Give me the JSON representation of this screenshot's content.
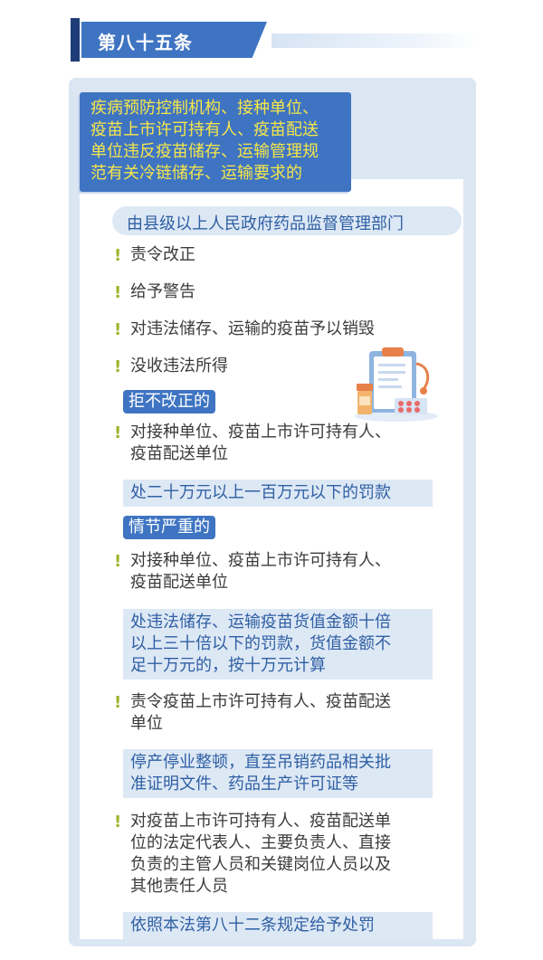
{
  "header": {
    "title": "第八十五条"
  },
  "title_box": {
    "lines": [
      "疾病预防控制机构、接种单位、",
      "疫苗上市许可持有人、疫苗配送",
      "单位违反疫苗储存、运输管理规",
      "范有关冷链储存、运输要求的"
    ]
  },
  "authority": "由县级以上人民政府药品监督管理部门",
  "penalties": [
    "责令改正",
    "给予警告",
    "对违法储存、运输的疫苗予以销毁",
    "没收违法所得"
  ],
  "refuse": {
    "badge": "拒不改正的",
    "target_lines": [
      "对接种单位、疫苗上市许可持有人、",
      "疫苗配送单位"
    ],
    "result": "处二十万元以上一百万元以下的罚款"
  },
  "serious": {
    "badge": "情节严重的",
    "items": [
      {
        "target_lines": [
          "对接种单位、疫苗上市许可持有人、",
          "疫苗配送单位"
        ],
        "result_lines": [
          "处违法储存、运输疫苗货值金额十倍",
          "以上三十倍以下的罚款，货值金额不",
          "足十万元的，按十万元计算"
        ]
      },
      {
        "target_lines": [
          "责令疫苗上市许可持有人、疫苗配送",
          "单位"
        ],
        "result_lines": [
          "停产停业整顿，直至吊销药品相关批",
          "准证明文件、药品生产许可证等"
        ]
      },
      {
        "target_lines": [
          "对疫苗上市许可持有人、疫苗配送单",
          "位的法定代表人、主要负责人、直接",
          "负责的主管人员和关键岗位人员以及",
          "其他责任人员"
        ],
        "result_lines": [
          "依照本法第八十二条规定给予处罚"
        ]
      }
    ]
  },
  "colors": {
    "primary": "#3e74c2",
    "navy": "#1e3d78",
    "panel": "#dbe6f3",
    "highlight_text": "#f6e64a",
    "bullet": "#9fb32a",
    "body_text": "#3b3b3b",
    "result_text": "#2f5fa3"
  },
  "icons": [
    "clipboard-icon",
    "medicine-bottle-icon",
    "pill-blister-icon",
    "exclamation-icon"
  ]
}
